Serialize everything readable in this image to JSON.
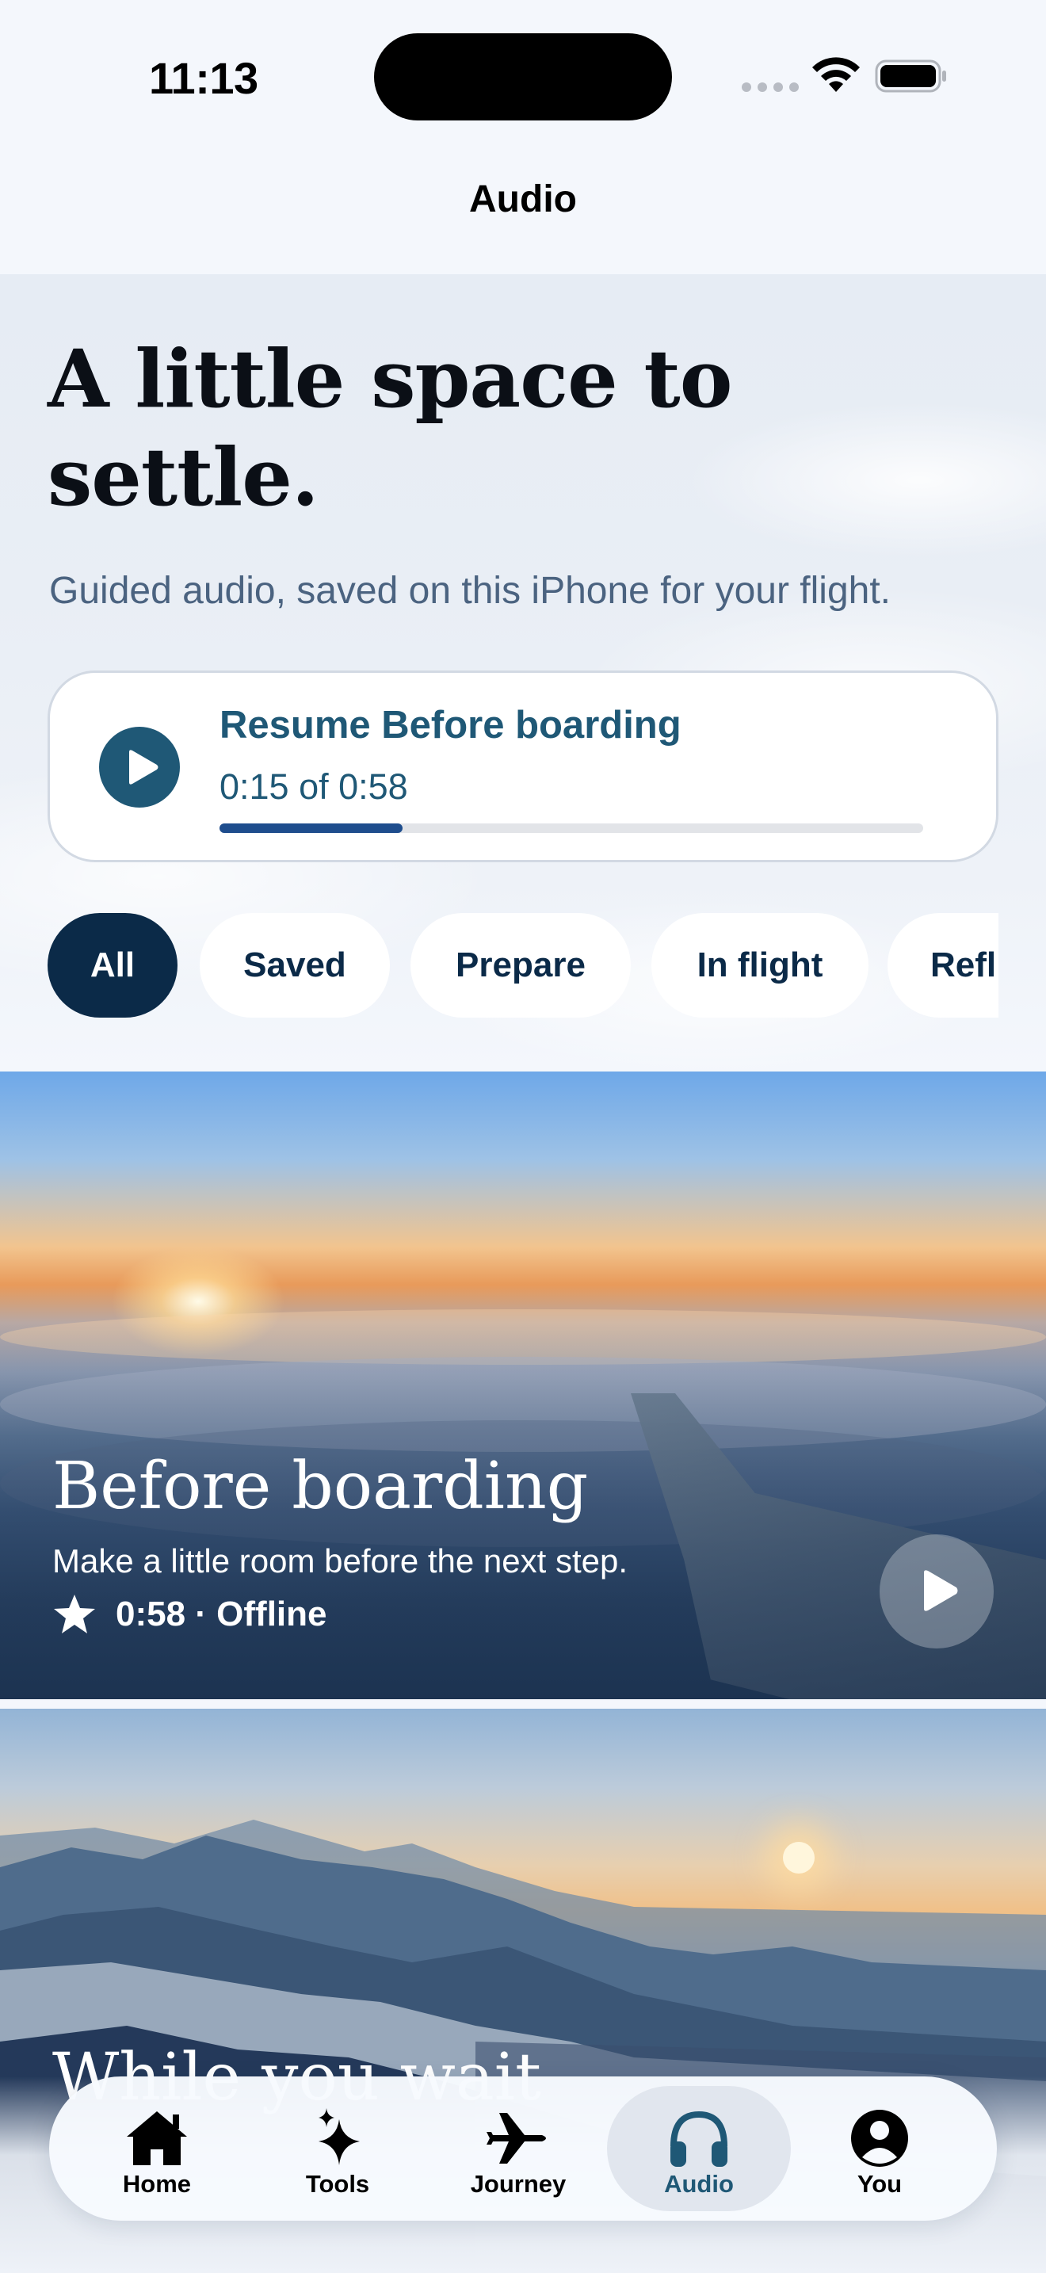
{
  "status_bar": {
    "time": "11:13"
  },
  "nav": {
    "title": "Audio"
  },
  "hero": {
    "title": "A little space to settle.",
    "subtitle": "Guided audio, saved on this iPhone for your flight."
  },
  "resume": {
    "title": "Resume Before boarding",
    "time": "0:15 of 0:58",
    "progress": 0.26
  },
  "filters": {
    "chips": [
      "All",
      "Saved",
      "Prepare",
      "In flight",
      "Refl"
    ],
    "selected": "All"
  },
  "cards": [
    {
      "title": "Before boarding",
      "description": "Make a little room before the next step.",
      "meta": "0:58 · Offline",
      "saved_icon": "star-icon"
    },
    {
      "title": "While you wait"
    }
  ],
  "tabbar": {
    "items": [
      {
        "label": "Home",
        "icon": "house-icon"
      },
      {
        "label": "Tools",
        "icon": "sparkles-icon"
      },
      {
        "label": "Journey",
        "icon": "airplane-icon"
      },
      {
        "label": "Audio",
        "icon": "headphones-icon"
      },
      {
        "label": "You",
        "icon": "person-circle-icon"
      }
    ],
    "active": "Audio"
  },
  "colors": {
    "accent": "#1f5876",
    "chip_active": "#0b2a48",
    "progress": "#1e4d8d",
    "background": "#f4f7fc"
  }
}
